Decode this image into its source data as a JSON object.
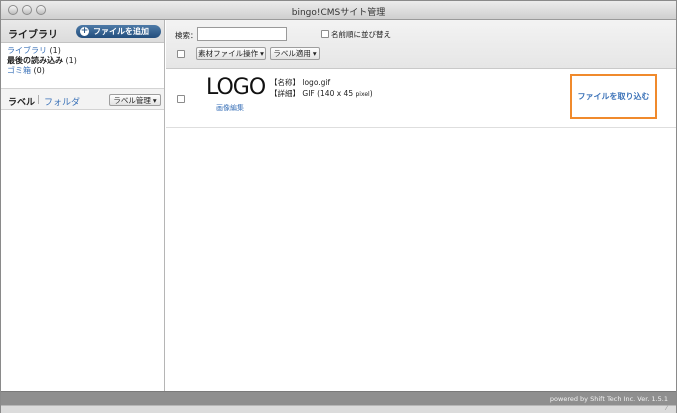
{
  "window": {
    "title": "bingo!CMSサイト管理"
  },
  "sidebar": {
    "title": "ライブラリ",
    "add_file_label": "ファイルを追加",
    "items": [
      {
        "label": "ライブラリ",
        "count": "(1)"
      },
      {
        "label": "最後の読み込み",
        "count": "(1)"
      },
      {
        "label": "ゴミ箱",
        "count": "(0)"
      }
    ],
    "tabs": {
      "label": "ラベル",
      "separator": "|",
      "folder": "フォルダ"
    },
    "label_manage_button": "ラベル管理"
  },
  "toolbar": {
    "search_label": "検索：",
    "search_value": "",
    "sort_by_name_label": "名前順に並び替え",
    "file_ops_button": "素材ファイル操作",
    "label_apply_button": "ラベル適用"
  },
  "files": [
    {
      "thumb_text": "LOGO",
      "image_edit_link": "画像編集",
      "name_line": "【名称】 logo.gif",
      "detail_prefix": "【詳細】 GIF (140 x 45 ",
      "detail_unit": "pixel",
      "detail_suffix": ")",
      "import_button": "ファイルを取り込む"
    }
  ],
  "footer": {
    "text": "powered by Shift Tech Inc. Ver. 1.5.1"
  },
  "colors": {
    "accent_border": "#f08a2c",
    "link": "#3b72b8",
    "brand_button": "#2f5c8a"
  }
}
